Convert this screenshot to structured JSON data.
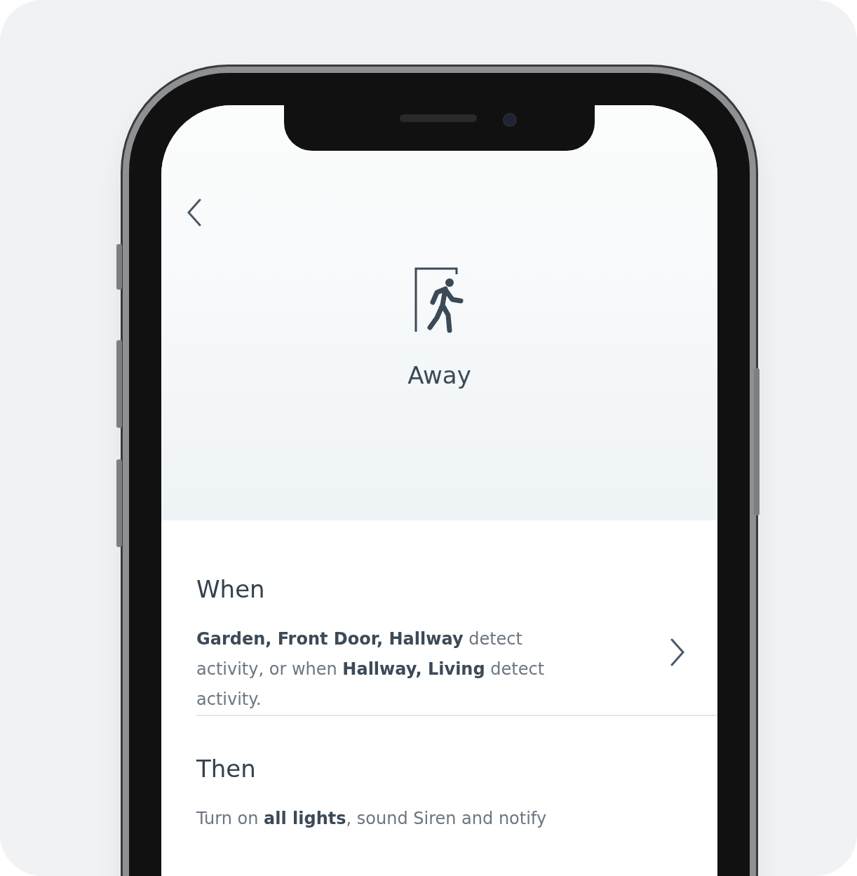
{
  "scene": {
    "title": "Away"
  },
  "sections": [
    {
      "heading": "When",
      "text": "**Garden, Front Door, Hallway** detect activity, or when **Hallway, Living** detect activity.",
      "chevron": true
    },
    {
      "heading": "Then",
      "text": "Turn on **all lights**, sound Siren and notify",
      "chevron": false
    }
  ]
}
